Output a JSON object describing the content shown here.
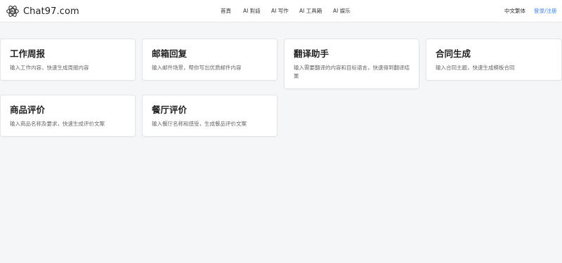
{
  "header": {
    "brand": "Chat97.com",
    "nav": [
      {
        "label": "首頁"
      },
      {
        "label": "AI 對話"
      },
      {
        "label": "AI 写作"
      },
      {
        "label": "AI 工具箱"
      },
      {
        "label": "AI 娱乐"
      }
    ],
    "lang": "中文繁体",
    "login": "登录/注册"
  },
  "cards": [
    {
      "title": "工作周报",
      "desc": "输入工作内容，快速生成周报内容"
    },
    {
      "title": "邮箱回复",
      "desc": "输入邮件场景，帮你写出优质邮件内容"
    },
    {
      "title": "翻译助手",
      "desc": "输入需要翻译的内容和目标语言，快速得到翻译结果"
    },
    {
      "title": "合同生成",
      "desc": "输入合同主题，快速生成模板合同"
    },
    {
      "title": "商品评价",
      "desc": "输入商品名称及要求，快速生成评价文案"
    },
    {
      "title": "餐厅评价",
      "desc": "输入餐厅名称和感受，生成餐品评价文案"
    }
  ],
  "colors": {
    "page_bg": "#f5f6f8",
    "card_bg": "#ffffff",
    "accent": "#3b82f6"
  }
}
